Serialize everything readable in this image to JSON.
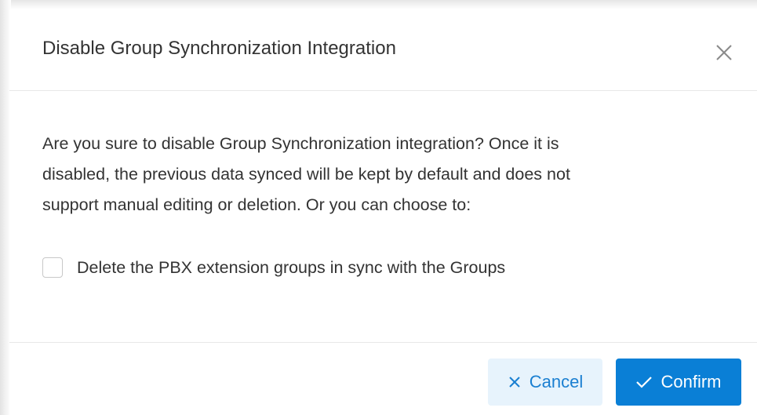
{
  "dialog": {
    "title": "Disable Group Synchronization Integration",
    "message_line1": "Are you sure to disable Group Synchronization integration? Once it is",
    "message_line2": "disabled, the previous data synced will be kept by default and does not",
    "message_line3": "support manual editing or deletion. Or you can choose to:",
    "checkbox_label": "Delete the PBX extension groups in sync with the Groups",
    "checkbox_checked": false,
    "cancel_label": "Cancel",
    "confirm_label": "Confirm"
  },
  "icons": {
    "close": "close-icon",
    "cancel": "x-icon",
    "confirm": "check-icon"
  },
  "colors": {
    "primary": "#0a7fd6",
    "cancel_bg": "#e7f3fc",
    "cancel_text": "#1a7fd1",
    "text": "#333333"
  }
}
